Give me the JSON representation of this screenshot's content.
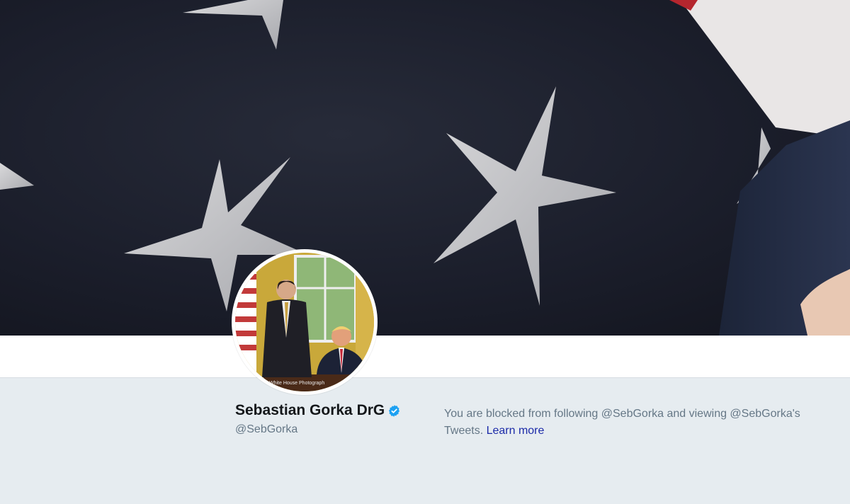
{
  "profile": {
    "display_name": "Sebastian Gorka DrG",
    "handle": "@SebGorka",
    "verified": true,
    "verified_icon": "verified-badge-icon"
  },
  "blocked_notice": {
    "text": "You are blocked from following @SebGorka and viewing @SebGorka's Tweets.",
    "link_label": "Learn more"
  },
  "avatar": {
    "caption": "White House Photograph"
  },
  "colors": {
    "background": "#e6ecf0",
    "name": "#14171a",
    "muted": "#657786",
    "link": "#1b2aa8",
    "verified": "#1da1f2"
  }
}
